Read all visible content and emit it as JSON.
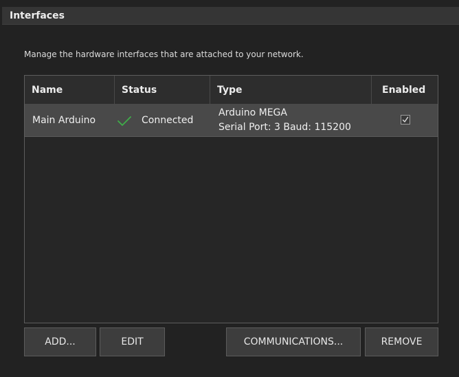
{
  "panel": {
    "title": "Interfaces",
    "description": "Manage the hardware interfaces that are attached to your network."
  },
  "table": {
    "columns": [
      "Name",
      "Status",
      "Type",
      "Enabled"
    ],
    "rows": [
      {
        "name": "Main Arduino",
        "status": "Connected",
        "status_icon": "check-icon",
        "type_line1": "Arduino MEGA",
        "type_line2": "Serial Port: 3 Baud: 115200",
        "enabled": true
      }
    ]
  },
  "buttons": {
    "add": "ADD...",
    "edit": "EDIT",
    "communications": "COMMUNICATIONS...",
    "remove": "REMOVE"
  },
  "colors": {
    "background": "#222222",
    "selected_row": "#494949",
    "status_ok": "#3fae49"
  }
}
